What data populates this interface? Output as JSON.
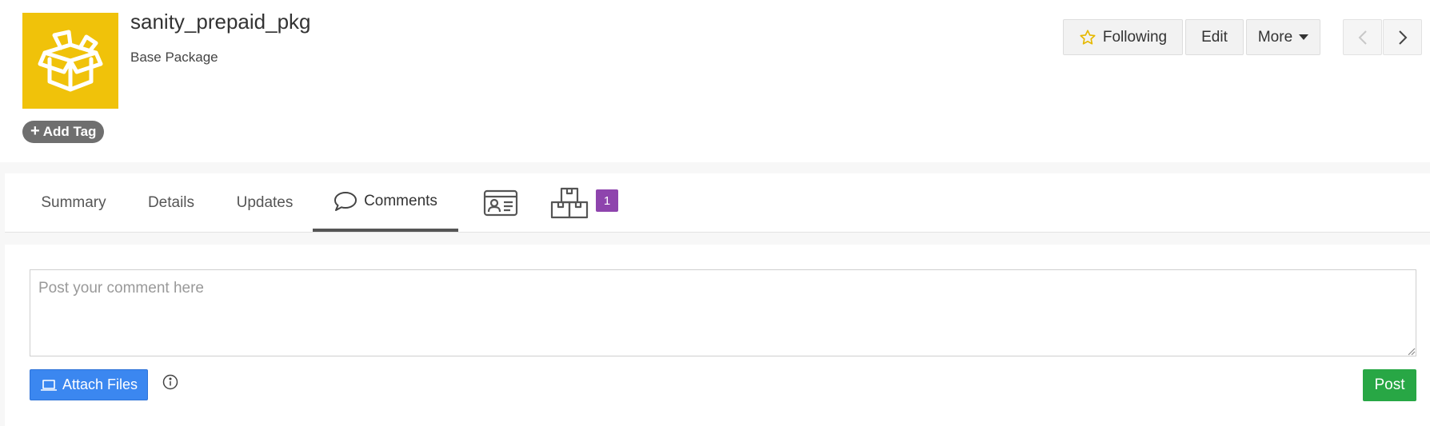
{
  "header": {
    "title": "sanity_prepaid_pkg",
    "subtitle": "Base Package",
    "add_tag_label": "Add Tag",
    "logo_icon": "open-box-icon",
    "logo_color": "#f0c20a"
  },
  "actions": {
    "following_label": "Following",
    "edit_label": "Edit",
    "more_label": "More"
  },
  "tabs": [
    {
      "label": "Summary"
    },
    {
      "label": "Details"
    },
    {
      "label": "Updates"
    },
    {
      "label": "Comments",
      "icon": "speech-bubble-icon",
      "active": true
    },
    {
      "label": "",
      "icon": "contact-card-icon"
    },
    {
      "label": "",
      "icon": "boxes-icon",
      "badge": "1"
    }
  ],
  "comments": {
    "placeholder": "Post your comment here",
    "attach_label": "Attach Files",
    "post_label": "Post"
  },
  "colors": {
    "accent_blue": "#3b87f0",
    "post_green": "#28a745",
    "badge_purple": "#8e44ad"
  }
}
